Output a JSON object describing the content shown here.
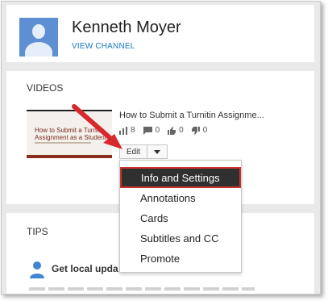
{
  "channel": {
    "name": "Kenneth Moyer",
    "view_channel_label": "VIEW CHANNEL"
  },
  "videos": {
    "heading": "VIDEOS",
    "item": {
      "title": "How to Submit a Turnitin Assignme...",
      "thumbnail_line1": "How to Submit a Turnit",
      "thumbnail_line2": "Assignment as a Student",
      "views": "8",
      "comments": "0",
      "likes": "0",
      "dislikes": "0"
    },
    "edit_label": "Edit"
  },
  "menu": {
    "items": [
      "Info and Settings",
      "Annotations",
      "Cards",
      "Subtitles and CC",
      "Promote"
    ],
    "highlighted_index": 0
  },
  "tips": {
    "heading": "TIPS",
    "item_text": "Get local upda"
  },
  "colors": {
    "link": "#167ac6",
    "highlight_border": "#c9332f",
    "arrow": "#d9272e"
  }
}
